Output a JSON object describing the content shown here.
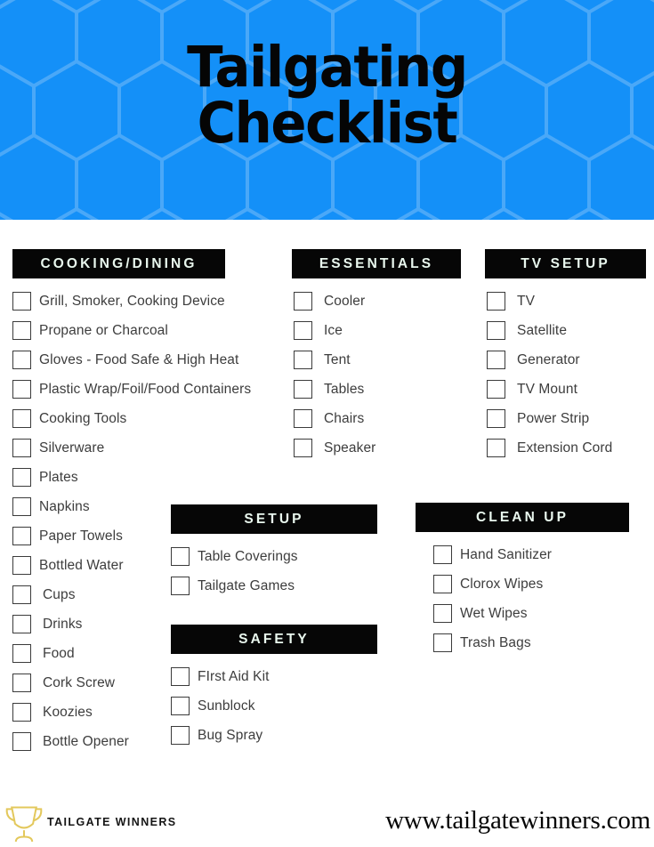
{
  "header": {
    "title": "Tailgating\nChecklist",
    "bg_color": "#1490f8",
    "hex_line_color": "#4aa8f8",
    "title_color": "#050505"
  },
  "theme": {
    "group_header_bg": "#060606",
    "group_header_text": "#e9f7ee",
    "item_text": "#3d3d3d",
    "checkbox_border": "#3b3b3b",
    "trophy_color": "#e3c85c"
  },
  "groups": {
    "cooking": {
      "title": "COOKING/DINING",
      "items": [
        "Grill, Smoker, Cooking Device",
        "Propane or Charcoal",
        "Gloves - Food Safe & High Heat",
        "Plastic Wrap/Foil/Food Containers",
        "Cooking Tools",
        "Silverware",
        "Plates",
        "Napkins",
        "Paper Towels",
        "Bottled Water",
        "Cups",
        "Drinks",
        "Food",
        "Cork Screw",
        "Koozies",
        "Bottle Opener"
      ]
    },
    "essentials": {
      "title": "ESSENTIALS",
      "items": [
        "Cooler",
        "Ice",
        "Tent",
        "Tables",
        "Chairs",
        "Speaker"
      ]
    },
    "tv_setup": {
      "title": "TV SETUP",
      "items": [
        "TV",
        "Satellite",
        "Generator",
        "TV Mount",
        "Power Strip",
        "Extension Cord"
      ]
    },
    "setup": {
      "title": "SETUP",
      "items": [
        "Table Coverings",
        "Tailgate Games"
      ]
    },
    "safety": {
      "title": "SAFETY",
      "items": [
        "FIrst Aid Kit",
        "Sunblock",
        "Bug Spray"
      ]
    },
    "cleanup": {
      "title": "CLEAN UP",
      "items": [
        "Hand Sanitizer",
        "Clorox Wipes",
        "Wet Wipes",
        "Trash Bags"
      ]
    }
  },
  "footer": {
    "brand_name": "TAILGATE WINNERS",
    "logo_icon": "trophy-icon",
    "url": "www.tailgatewinners.com"
  }
}
